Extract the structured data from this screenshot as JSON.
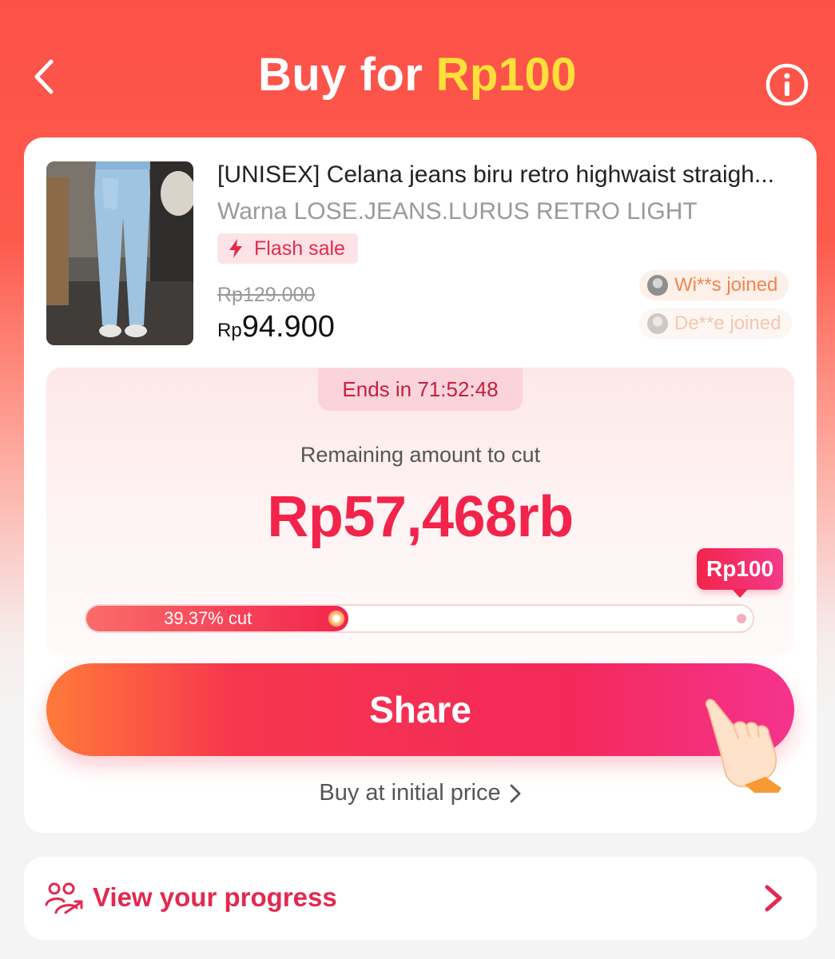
{
  "header": {
    "title_prefix": "Buy for",
    "title_price": "Rp100",
    "back_icon": "chevron-left-icon",
    "info_icon": "info-icon"
  },
  "product": {
    "title": "[UNISEX] Celana jeans biru retro highwaist straigh...",
    "variant": "Warna LOSE.JEANS.LURUS RETRO LIGHT",
    "badge": "Flash sale",
    "badge_icon": "lightning-icon",
    "original_price": "Rp129.000",
    "price_currency": "Rp",
    "price_amount": "94.900"
  },
  "joined": [
    {
      "text": "Wi**s joined"
    },
    {
      "text": "De**e joined"
    }
  ],
  "cut": {
    "timer": "Ends in 71:52:48",
    "remaining_label": "Remaining amount to cut",
    "remaining_amount": "Rp57,468rb",
    "progress_label": "39.37% cut",
    "progress_fraction": 0.3937,
    "target_tag": "Rp100"
  },
  "actions": {
    "share": "Share",
    "buy_initial": "Buy at initial price"
  },
  "progress_card": {
    "label": "View your progress",
    "icon": "people-progress-icon"
  },
  "colors": {
    "accent": "#f2244b",
    "header_bg": "#fd5148",
    "title_price": "#ffe03a",
    "joined_text": "#f08550"
  }
}
